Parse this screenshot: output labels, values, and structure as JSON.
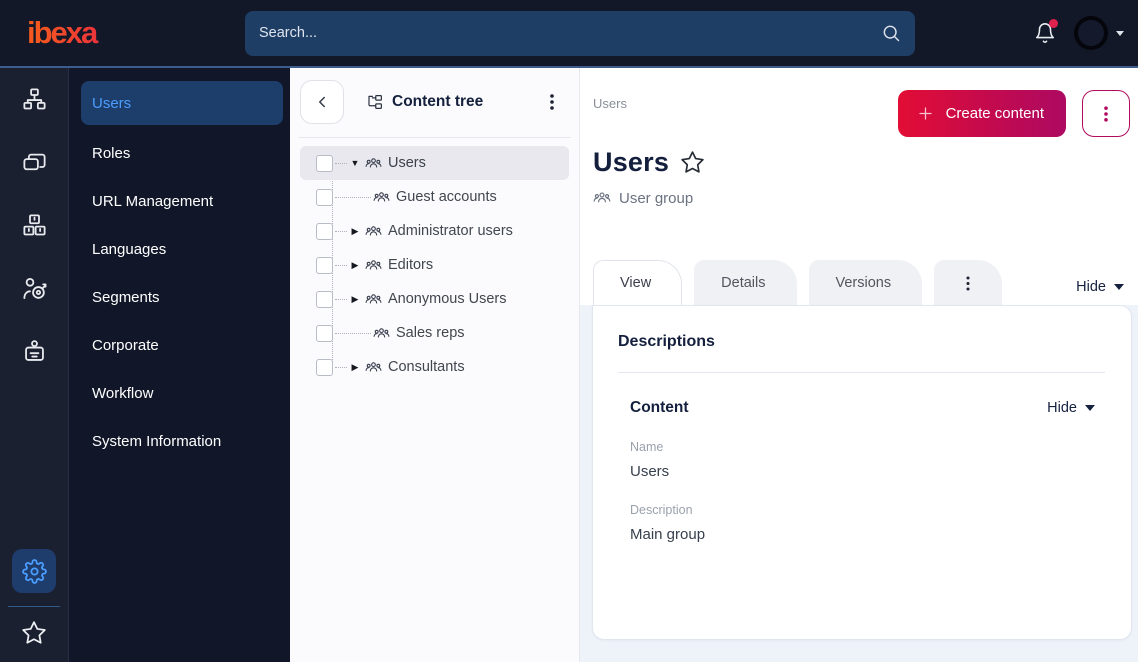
{
  "topbar": {
    "logo": "ibexa",
    "search_placeholder": "Search...",
    "has_notification": true
  },
  "nav_rail": {
    "icons": [
      "sitemap-icon",
      "pages-icon",
      "products-icon",
      "personalization-icon",
      "badge-icon",
      "gear-icon",
      "star-icon"
    ],
    "active_icon": "gear-icon"
  },
  "sidebar": {
    "items": [
      {
        "label": "Users",
        "active": true
      },
      {
        "label": "Roles",
        "active": false
      },
      {
        "label": "URL Management",
        "active": false
      },
      {
        "label": "Languages",
        "active": false
      },
      {
        "label": "Segments",
        "active": false
      },
      {
        "label": "Corporate",
        "active": false
      },
      {
        "label": "Workflow",
        "active": false
      },
      {
        "label": "System Information",
        "active": false
      }
    ]
  },
  "content_tree": {
    "title": "Content tree",
    "items": [
      {
        "label": "Users",
        "arrow": "▼",
        "state": "expanded",
        "selected": true
      },
      {
        "label": "Guest accounts",
        "arrow": "",
        "state": "leaf",
        "selected": false
      },
      {
        "label": "Administrator users",
        "arrow": "▶",
        "state": "collapsed",
        "selected": false
      },
      {
        "label": "Editors",
        "arrow": "▶",
        "state": "collapsed",
        "selected": false
      },
      {
        "label": "Anonymous Users",
        "arrow": "▶",
        "state": "collapsed",
        "selected": false
      },
      {
        "label": "Sales reps",
        "arrow": "",
        "state": "leaf",
        "selected": false
      },
      {
        "label": "Consultants",
        "arrow": "▶",
        "state": "collapsed",
        "selected": false
      }
    ]
  },
  "main": {
    "breadcrumb": "Users",
    "create_button": "Create content",
    "title": "Users",
    "content_type": "User group",
    "tabs": [
      {
        "label": "View",
        "active": true
      },
      {
        "label": "Details",
        "active": false
      },
      {
        "label": "Versions",
        "active": false
      }
    ],
    "hide_toggle": "Hide",
    "card": {
      "heading": "Descriptions",
      "section_title": "Content",
      "section_toggle": "Hide",
      "fields": [
        {
          "label": "Name",
          "value": "Users"
        },
        {
          "label": "Description",
          "value": "Main group"
        }
      ]
    }
  },
  "colors": {
    "brand_gradient_start": "#e20d35",
    "brand_gradient_end": "#ad0a62",
    "accent_blue": "#4b9eff",
    "topbar_bg": "#131828",
    "topbar_line": "#3c5c8e",
    "search_bg": "#1f3e66",
    "notification_dot": "#e0224e",
    "selected_menu_bg": "#1d3d6b",
    "content_bg": "#eef2f9"
  }
}
